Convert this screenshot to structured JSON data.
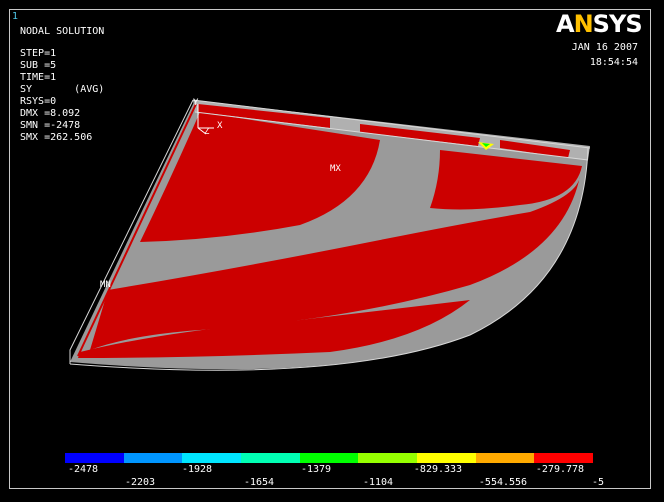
{
  "window": {
    "number": "1"
  },
  "logo": {
    "prefix": "A",
    "n": "N",
    "suffix": "SYS"
  },
  "date": "JAN 16 2007",
  "time": "18:54:54",
  "solution": {
    "title": "NODAL SOLUTION",
    "lines": [
      "STEP=1",
      "SUB =5",
      "TIME=1",
      "SY       (AVG)",
      "RSYS=0",
      "DMX =8.092",
      "SMN =-2478",
      "SMX =262.506"
    ]
  },
  "model_labels": {
    "max": "MX",
    "min": "MN",
    "axis_y": "Y",
    "axis_x": "X",
    "axis_z": "Z"
  },
  "colors": {
    "model_red": "#cc0000",
    "model_gray": "#9a9a9a",
    "edge": "#d8d8d8",
    "frame": "#c8c8c8",
    "window_number": "#4ec7e8",
    "logo_n": "#ffc000"
  },
  "legend": {
    "colors": [
      "#0000ff",
      "#0096ff",
      "#00e6ff",
      "#00ffb4",
      "#00ff00",
      "#96ff00",
      "#ffff00",
      "#ffaa00",
      "#ff0000"
    ],
    "labels_top": [
      "-2478",
      "-1928",
      "-1379",
      "-829.333",
      "-279.778"
    ],
    "labels_bottom": [
      "-2203",
      "-1654",
      "-1104",
      "-554.556",
      "-5"
    ]
  }
}
